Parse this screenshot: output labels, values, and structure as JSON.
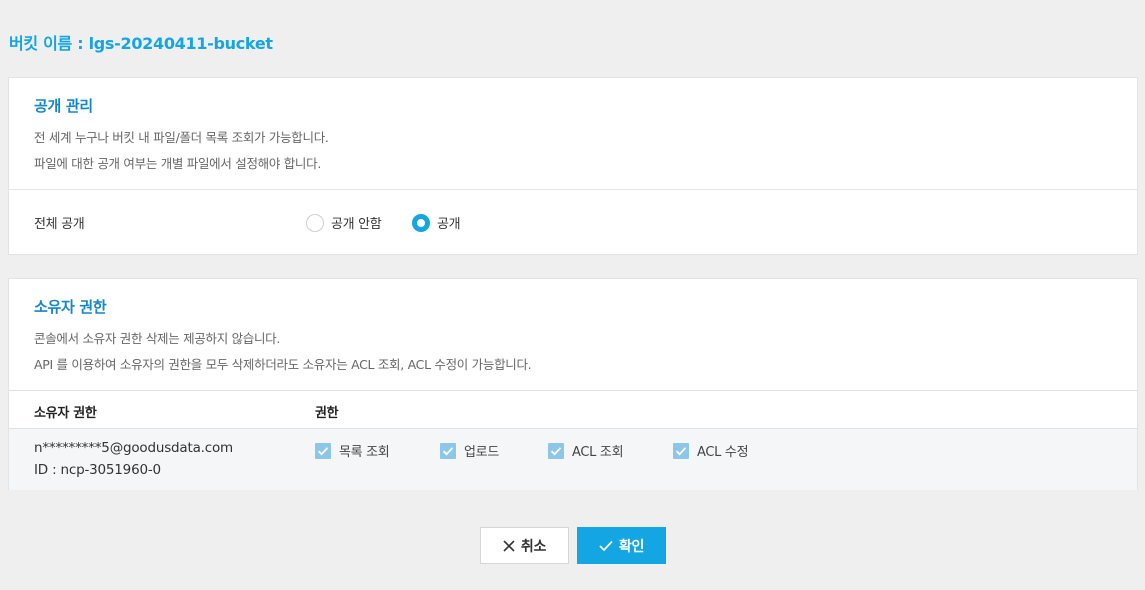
{
  "bucket": {
    "title": "버킷 이름 : lgs-20240411-bucket"
  },
  "public_panel": {
    "title": "공개 관리",
    "desc_line1": "전 세계 누구나 버킷 내 파일/폴더 목록 조회가 가능합니다.",
    "desc_line2": "파일에 대한 공개 여부는 개별 파일에서 설정해야 합니다.",
    "row_label": "전체 공개",
    "options": [
      {
        "label": "공개 안함",
        "selected": false
      },
      {
        "label": "공개",
        "selected": true
      }
    ]
  },
  "owner_panel": {
    "title": "소유자 권한",
    "desc_line1": "콘솔에서 소유자 권한 삭제는 제공하지 않습니다.",
    "desc_line2": "API 를 이용하여 소유자의 권한을 모두 삭제하더라도 소유자는 ACL 조회, ACL 수정이 가능합니다.",
    "columns": [
      "소유자 권한",
      "권한"
    ],
    "row": {
      "email": "n*********5@goodusdata.com",
      "id": "ID : ncp-3051960-0",
      "permissions": [
        {
          "label": "목록 조회",
          "checked": true
        },
        {
          "label": "업로드",
          "checked": true
        },
        {
          "label": "ACL 조회",
          "checked": true
        },
        {
          "label": "ACL 수정",
          "checked": true
        }
      ]
    }
  },
  "actions": {
    "cancel_label": "취소",
    "confirm_label": "확인"
  },
  "colors": {
    "accent": "#14a5e3",
    "panel_title": "#1587c9",
    "checkbox": "#8ec6ea",
    "background": "#efefef"
  }
}
